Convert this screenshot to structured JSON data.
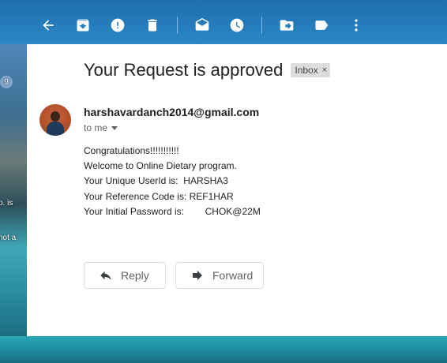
{
  "toolbar": {
    "icons": [
      "back-icon",
      "archive-icon",
      "report-spam-icon",
      "delete-icon",
      "mark-unread-icon",
      "snooze-icon",
      "move-to-icon",
      "labels-icon",
      "more-icon"
    ]
  },
  "background": {
    "left_snippets": [
      "9",
      "o. is",
      "not a"
    ]
  },
  "email": {
    "subject": "Your Request is approved",
    "label": "Inbox",
    "label_close": "×",
    "sender": "harshavardanch2014@gmail.com",
    "recipient": "to me",
    "body_lines": [
      "Congratulations!!!!!!!!!!!",
      "Welcome to Online Dietary program.",
      "Your Unique UserId is:  HARSHA3",
      "Your Reference Code is: REF1HAR",
      "Your Initial Password is:        CHOK@22M"
    ]
  },
  "actions": {
    "reply_label": "Reply",
    "forward_label": "Forward"
  }
}
